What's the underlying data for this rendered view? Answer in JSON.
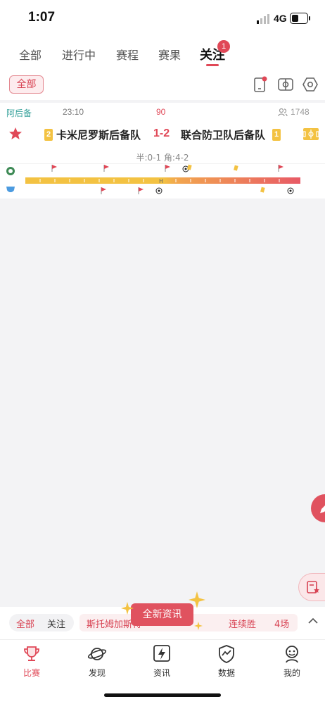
{
  "status_bar": {
    "time": "1:07",
    "network": "4G"
  },
  "tabs": {
    "items": [
      {
        "label": "全部"
      },
      {
        "label": "进行中"
      },
      {
        "label": "赛程"
      },
      {
        "label": "赛果"
      },
      {
        "label": "关注",
        "active": true,
        "badge": "1"
      }
    ]
  },
  "filter": {
    "all_label": "全部"
  },
  "match": {
    "league": "阿后备",
    "time": "23:10",
    "minute": "90",
    "viewers": "1748",
    "home_team": "卡米尼罗斯后备队",
    "home_rank": "2",
    "score": "1-2",
    "away_team": "联合防卫队后备队",
    "away_rank": "1",
    "half_info": "半:0-1 角:4-2",
    "colors": {
      "accent": "#e04857",
      "rank_badge": "#f3c242",
      "bar_home": "#f3c242",
      "bar_away": "#e85a66"
    }
  },
  "info_bar": {
    "seg_all": "全部",
    "seg_follow": "关注",
    "ticker_team": "斯托姆加斯特",
    "ticker_stat": "连续胜",
    "ticker_count": "4场",
    "popup": "全新资讯"
  },
  "bottom_nav": [
    {
      "label": "比赛",
      "icon": "trophy-icon",
      "active": true
    },
    {
      "label": "发现",
      "icon": "planet-icon"
    },
    {
      "label": "资讯",
      "icon": "news-bolt-icon"
    },
    {
      "label": "数据",
      "icon": "chart-shield-icon"
    },
    {
      "label": "我的",
      "icon": "profile-icon"
    }
  ]
}
